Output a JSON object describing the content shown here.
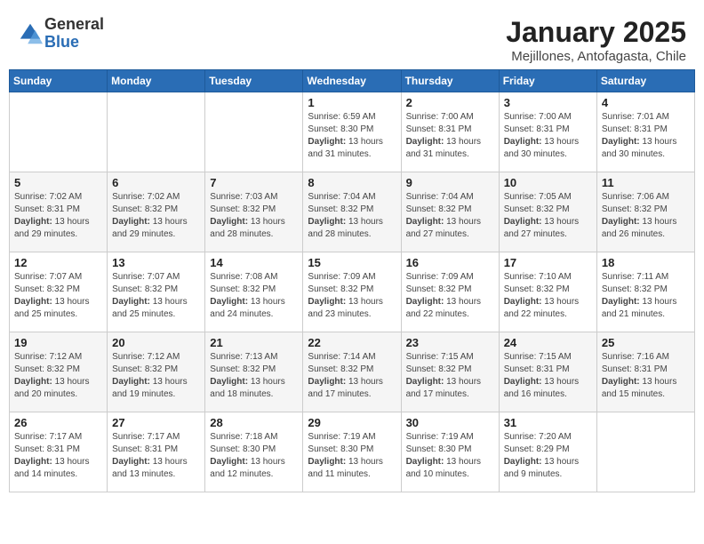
{
  "header": {
    "logo_general": "General",
    "logo_blue": "Blue",
    "title": "January 2025",
    "subtitle": "Mejillones, Antofagasta, Chile"
  },
  "weekdays": [
    "Sunday",
    "Monday",
    "Tuesday",
    "Wednesday",
    "Thursday",
    "Friday",
    "Saturday"
  ],
  "weeks": [
    [
      {
        "day": "",
        "info": ""
      },
      {
        "day": "",
        "info": ""
      },
      {
        "day": "",
        "info": ""
      },
      {
        "day": "1",
        "info": "Sunrise: 6:59 AM\nSunset: 8:30 PM\nDaylight: 13 hours and 31 minutes."
      },
      {
        "day": "2",
        "info": "Sunrise: 7:00 AM\nSunset: 8:31 PM\nDaylight: 13 hours and 31 minutes."
      },
      {
        "day": "3",
        "info": "Sunrise: 7:00 AM\nSunset: 8:31 PM\nDaylight: 13 hours and 30 minutes."
      },
      {
        "day": "4",
        "info": "Sunrise: 7:01 AM\nSunset: 8:31 PM\nDaylight: 13 hours and 30 minutes."
      }
    ],
    [
      {
        "day": "5",
        "info": "Sunrise: 7:02 AM\nSunset: 8:31 PM\nDaylight: 13 hours and 29 minutes."
      },
      {
        "day": "6",
        "info": "Sunrise: 7:02 AM\nSunset: 8:32 PM\nDaylight: 13 hours and 29 minutes."
      },
      {
        "day": "7",
        "info": "Sunrise: 7:03 AM\nSunset: 8:32 PM\nDaylight: 13 hours and 28 minutes."
      },
      {
        "day": "8",
        "info": "Sunrise: 7:04 AM\nSunset: 8:32 PM\nDaylight: 13 hours and 28 minutes."
      },
      {
        "day": "9",
        "info": "Sunrise: 7:04 AM\nSunset: 8:32 PM\nDaylight: 13 hours and 27 minutes."
      },
      {
        "day": "10",
        "info": "Sunrise: 7:05 AM\nSunset: 8:32 PM\nDaylight: 13 hours and 27 minutes."
      },
      {
        "day": "11",
        "info": "Sunrise: 7:06 AM\nSunset: 8:32 PM\nDaylight: 13 hours and 26 minutes."
      }
    ],
    [
      {
        "day": "12",
        "info": "Sunrise: 7:07 AM\nSunset: 8:32 PM\nDaylight: 13 hours and 25 minutes."
      },
      {
        "day": "13",
        "info": "Sunrise: 7:07 AM\nSunset: 8:32 PM\nDaylight: 13 hours and 25 minutes."
      },
      {
        "day": "14",
        "info": "Sunrise: 7:08 AM\nSunset: 8:32 PM\nDaylight: 13 hours and 24 minutes."
      },
      {
        "day": "15",
        "info": "Sunrise: 7:09 AM\nSunset: 8:32 PM\nDaylight: 13 hours and 23 minutes."
      },
      {
        "day": "16",
        "info": "Sunrise: 7:09 AM\nSunset: 8:32 PM\nDaylight: 13 hours and 22 minutes."
      },
      {
        "day": "17",
        "info": "Sunrise: 7:10 AM\nSunset: 8:32 PM\nDaylight: 13 hours and 22 minutes."
      },
      {
        "day": "18",
        "info": "Sunrise: 7:11 AM\nSunset: 8:32 PM\nDaylight: 13 hours and 21 minutes."
      }
    ],
    [
      {
        "day": "19",
        "info": "Sunrise: 7:12 AM\nSunset: 8:32 PM\nDaylight: 13 hours and 20 minutes."
      },
      {
        "day": "20",
        "info": "Sunrise: 7:12 AM\nSunset: 8:32 PM\nDaylight: 13 hours and 19 minutes."
      },
      {
        "day": "21",
        "info": "Sunrise: 7:13 AM\nSunset: 8:32 PM\nDaylight: 13 hours and 18 minutes."
      },
      {
        "day": "22",
        "info": "Sunrise: 7:14 AM\nSunset: 8:32 PM\nDaylight: 13 hours and 17 minutes."
      },
      {
        "day": "23",
        "info": "Sunrise: 7:15 AM\nSunset: 8:32 PM\nDaylight: 13 hours and 17 minutes."
      },
      {
        "day": "24",
        "info": "Sunrise: 7:15 AM\nSunset: 8:31 PM\nDaylight: 13 hours and 16 minutes."
      },
      {
        "day": "25",
        "info": "Sunrise: 7:16 AM\nSunset: 8:31 PM\nDaylight: 13 hours and 15 minutes."
      }
    ],
    [
      {
        "day": "26",
        "info": "Sunrise: 7:17 AM\nSunset: 8:31 PM\nDaylight: 13 hours and 14 minutes."
      },
      {
        "day": "27",
        "info": "Sunrise: 7:17 AM\nSunset: 8:31 PM\nDaylight: 13 hours and 13 minutes."
      },
      {
        "day": "28",
        "info": "Sunrise: 7:18 AM\nSunset: 8:30 PM\nDaylight: 13 hours and 12 minutes."
      },
      {
        "day": "29",
        "info": "Sunrise: 7:19 AM\nSunset: 8:30 PM\nDaylight: 13 hours and 11 minutes."
      },
      {
        "day": "30",
        "info": "Sunrise: 7:19 AM\nSunset: 8:30 PM\nDaylight: 13 hours and 10 minutes."
      },
      {
        "day": "31",
        "info": "Sunrise: 7:20 AM\nSunset: 8:29 PM\nDaylight: 13 hours and 9 minutes."
      },
      {
        "day": "",
        "info": ""
      }
    ]
  ]
}
